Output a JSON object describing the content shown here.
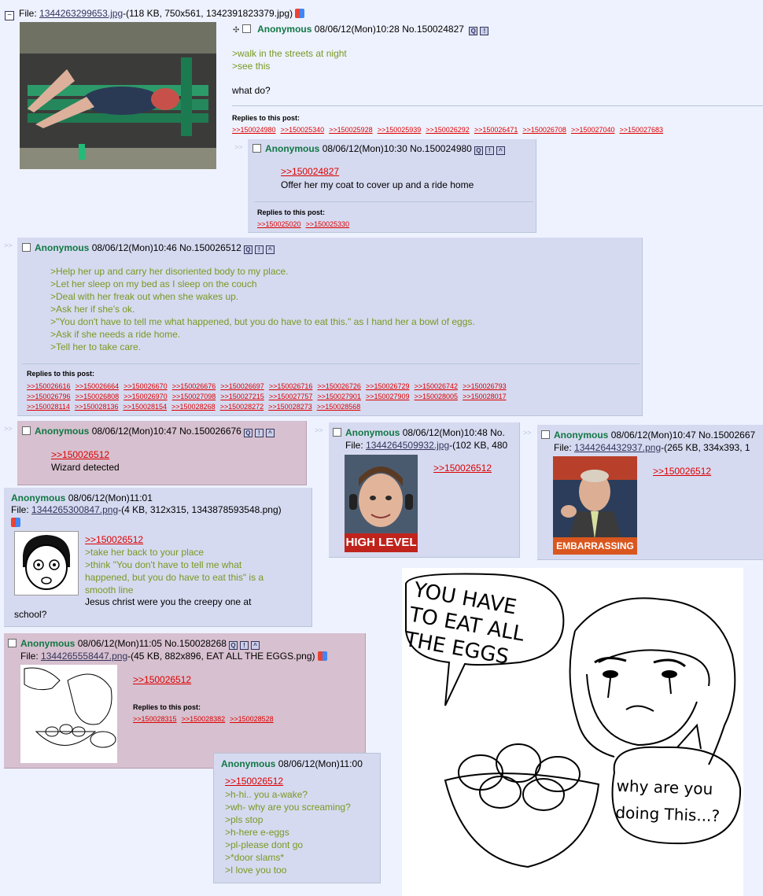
{
  "op": {
    "file_label": "File:",
    "file_name": "1344263299653.jpg",
    "file_info": "-(118 KB, 750x561, 1342391823379.jpg)",
    "name": "Anonymous",
    "datetime": "08/06/12(Mon)10:28",
    "post_no": "No.150024827",
    "lines": [
      ">walk in the streets at night",
      ">see this"
    ],
    "text": "what do?",
    "replies_header": "Replies to this post:",
    "replies": [
      ">>150024980",
      ">>150025340",
      ">>150025928",
      ">>150025939",
      ">>150026292",
      ">>150026471",
      ">>150026708",
      ">>150027040",
      ">>150027683"
    ]
  },
  "post1": {
    "name": "Anonymous",
    "datetime": "08/06/12(Mon)10:30",
    "post_no": "No.150024980",
    "quote": ">>150024827",
    "text": "Offer her my coat to cover up and a ride home",
    "replies_header": "Replies to this post:",
    "replies": [
      ">>150025020",
      ">>150025330"
    ]
  },
  "post2": {
    "name": "Anonymous",
    "datetime": "08/06/12(Mon)10:46",
    "post_no": "No.150026512",
    "lines": [
      ">Help her up and carry her disoriented body to my place.",
      ">Let her sleep on my bed as I sleep on the couch",
      ">Deal with her freak out when she wakes up.",
      ">Ask her if she's ok.",
      ">\"You don't have to tell me what happened, but you do have to eat this.\" as I hand her a bowl of eggs.",
      ">Ask if she needs a ride home.",
      ">Tell her to take care."
    ],
    "replies_header": "Replies to this post:",
    "replies_row1": [
      ">>150026616",
      ">>150026664",
      ">>150026670",
      ">>150026676",
      ">>150026697",
      ">>150026716",
      ">>150026726",
      ">>150026729",
      ">>150026742",
      ">>150026793"
    ],
    "replies_row2": [
      ">>150026796",
      ">>150026808",
      ">>150026970",
      ">>150027098",
      ">>150027215",
      ">>150027757",
      ">>150027901",
      ">>150027909",
      ">>150028005",
      ">>150028017"
    ],
    "replies_row3": [
      ">>150028114",
      ">>150028136",
      ">>150028154",
      ">>150028268",
      ">>150028272",
      ">>150028273",
      ">>150028568"
    ]
  },
  "post3": {
    "name": "Anonymous",
    "datetime": "08/06/12(Mon)10:47",
    "post_no": "No.150026676",
    "quote": ">>150026512",
    "text": "Wizard detected"
  },
  "post4": {
    "name": "Anonymous",
    "datetime": "08/06/12(Mon)10:48",
    "post_no": "No.",
    "file_label": "File:",
    "file_name": "1344264509932.jpg",
    "file_info": "-(102 KB, 480",
    "quote": ">>150026512",
    "caption": "HIGH LEVEL"
  },
  "post5": {
    "name": "Anonymous",
    "datetime": "08/06/12(Mon)10:47",
    "post_no": "No.15002667",
    "file_label": "File:",
    "file_name": "1344264432937.png",
    "file_info": "-(265 KB, 334x393, 1",
    "quote": ">>150026512",
    "caption": "EMBARRASSING"
  },
  "post6": {
    "name": "Anonymous",
    "datetime": "08/06/12(Mon)11:01",
    "file_label": "File:",
    "file_name": "1344265300847.png",
    "file_info": "-(4 KB, 312x315, 1343878593548.png)",
    "quote": ">>150026512",
    "lines": [
      ">take her back to your place",
      ">think \"You don't have to tell me what",
      "happened, but you do have to eat this\" is a",
      "smooth line"
    ],
    "text1": "Jesus christ were you the creepy one at",
    "text2": "school?"
  },
  "post7": {
    "name": "Anonymous",
    "datetime": "08/06/12(Mon)11:05",
    "post_no": "No.150028268",
    "file_label": "File:",
    "file_name": "1344265558447.png",
    "file_info": "-(45 KB, 882x896, EAT ALL THE EGGS.png)",
    "quote": ">>150026512",
    "replies_header": "Replies to this post:",
    "replies": [
      ">>150028315",
      ">>150028382",
      ">>150028528"
    ]
  },
  "post8": {
    "name": "Anonymous",
    "datetime": "08/06/12(Mon)11:00",
    "quote": ">>150026512",
    "lines": [
      ">h-hi.. you a-wake?",
      ">wh- why are you screaming?",
      ">pls stop",
      ">h-here e-eggs",
      ">pl-please dont go",
      ">*door slams*",
      ">I love you too"
    ]
  },
  "comic": {
    "speech_left": [
      "YOU HAVE",
      "TO EAT ALL",
      "THE EGGS"
    ],
    "speech_right": [
      "why are you",
      "doing This...?"
    ]
  },
  "icons": [
    "collapse-icon",
    "google-icon",
    "quote-icon",
    "report-icon",
    "image-search-icon"
  ]
}
